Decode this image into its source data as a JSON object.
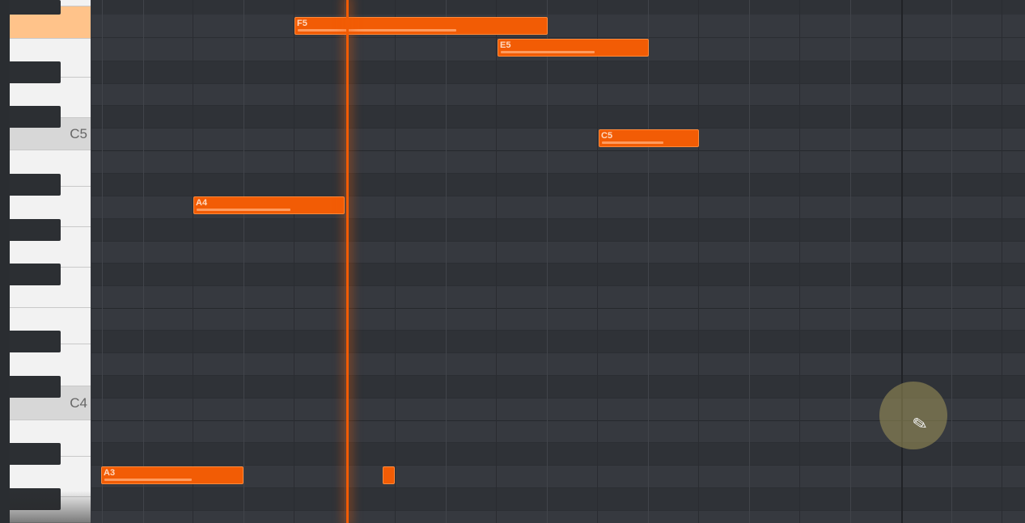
{
  "piano_roll": {
    "key_labels": {
      "c5": "C5",
      "c4": "C4"
    },
    "notes": [
      {
        "label": "F5"
      },
      {
        "label": "E5"
      },
      {
        "label": "C5"
      },
      {
        "label": "A4"
      },
      {
        "label": "A3"
      },
      {
        "label": ""
      }
    ]
  },
  "colors": {
    "note_fill": "#f25c05",
    "grid_bg": "#36393f",
    "highlight_key": "#ffc38a"
  },
  "cursor": {
    "icon": "pencil-icon"
  }
}
